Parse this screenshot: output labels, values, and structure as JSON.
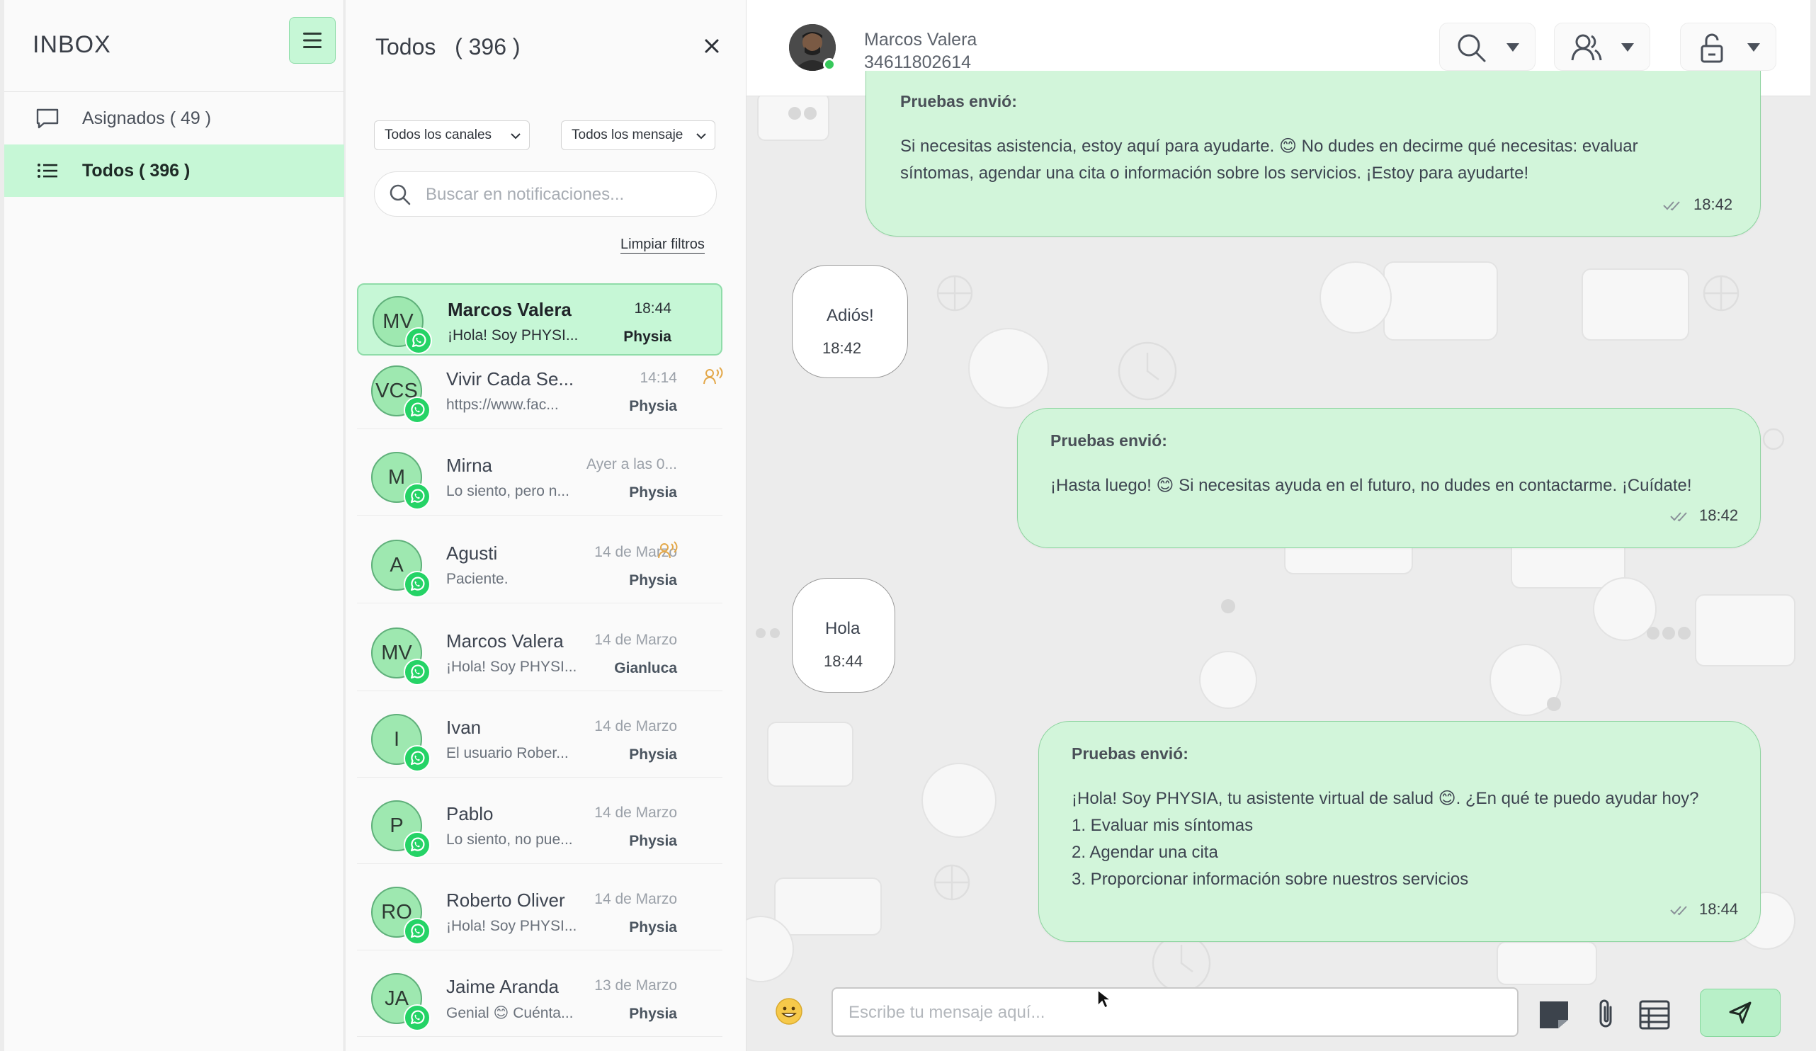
{
  "sidebar": {
    "title": "INBOX",
    "menu_icon": "hamburger-menu-icon",
    "nav": [
      {
        "label": "Asignados ( 49 )",
        "icon": "chat-bubble-icon",
        "active": false
      },
      {
        "label": "Todos ( 396 )",
        "icon": "list-icon",
        "active": true
      }
    ]
  },
  "list": {
    "title": "Todos   ( 396 )",
    "close_icon": "close-icon",
    "filters": {
      "channels": "Todos los canales",
      "messages": "Todos los mensaje"
    },
    "search_placeholder": "Buscar en notificaciones...",
    "clear_filters": "Limpiar filtros",
    "conversations": [
      {
        "initials": "MV",
        "name": "Marcos Valera",
        "preview": "¡Hola! Soy PHYSI...",
        "time": "18:44",
        "owner": "Physia",
        "active": true,
        "agent_icon": false
      },
      {
        "initials": "VCS",
        "name": "Vivir Cada Se...",
        "preview": "https://www.fac...",
        "time": "14:14",
        "owner": "Physia",
        "active": false,
        "agent_icon": true
      },
      {
        "initials": "M",
        "name": "Mirna",
        "preview": "Lo siento, pero n...",
        "time": "Ayer a las 0...",
        "owner": "Physia",
        "active": false,
        "agent_icon": false
      },
      {
        "initials": "A",
        "name": "Agusti",
        "preview": "Paciente.",
        "time": "14 de Marzo",
        "owner": "Physia",
        "active": false,
        "agent_icon": true
      },
      {
        "initials": "MV",
        "name": "Marcos Valera",
        "preview": "¡Hola! Soy PHYSI...",
        "time": "14 de Marzo",
        "owner": "Gianluca",
        "active": false,
        "agent_icon": false
      },
      {
        "initials": "I",
        "name": "Ivan",
        "preview": "El usuario Rober...",
        "time": "14 de Marzo",
        "owner": "Physia",
        "active": false,
        "agent_icon": false
      },
      {
        "initials": "P",
        "name": "Pablo",
        "preview": "Lo siento, no pue...",
        "time": "14 de Marzo",
        "owner": "Physia",
        "active": false,
        "agent_icon": false
      },
      {
        "initials": "RO",
        "name": "Roberto Oliver",
        "preview": "¡Hola! Soy PHYSI...",
        "time": "14 de Marzo",
        "owner": "Physia",
        "active": false,
        "agent_icon": false
      },
      {
        "initials": "JA",
        "name": "Jaime Aranda",
        "preview": "Genial 😊 Cuénta...",
        "time": "13 de Marzo",
        "owner": "Physia",
        "active": false,
        "agent_icon": false
      }
    ]
  },
  "chat": {
    "contact_name": "Marcos Valera",
    "contact_phone": "34611802614",
    "header_buttons": [
      "search-icon",
      "user-icon",
      "lock-icon"
    ],
    "messages": [
      {
        "direction": "out",
        "from": "Pruebas envió:",
        "text": "Si necesitas asistencia, estoy aquí para ayudarte. 😊 No dudes en decirme qué necesitas: evaluar\nsíntomas, agendar una cita o información sobre los servicios. ¡Estoy para ayudarte!",
        "time": "18:42"
      },
      {
        "direction": "in",
        "text": "Adiós!",
        "time": "18:42"
      },
      {
        "direction": "out",
        "from": "Pruebas envió:",
        "text": "¡Hasta luego! 😊 Si necesitas ayuda en el futuro, no dudes en contactarme. ¡Cuídate!",
        "time": "18:42"
      },
      {
        "direction": "in",
        "text": "Hola",
        "time": "18:44"
      },
      {
        "direction": "out",
        "from": "Pruebas envió:",
        "text": "¡Hola! Soy PHYSIA, tu asistente virtual de salud 😊. ¿En qué te puedo ayudar hoy?\n1. Evaluar mis síntomas\n2. Agendar una cita\n3. Proporcionar información sobre nuestros servicios",
        "time": "18:44"
      }
    ],
    "composer": {
      "placeholder": "Escribe tu mensaje aquí...",
      "emoji_icon": "emoji-icon",
      "buttons": [
        "note-icon",
        "paperclip-icon",
        "table-icon",
        "send-icon"
      ]
    }
  },
  "colors": {
    "accent_green": "#c6f7d6",
    "bubble_out": "#d2f5da",
    "border_green": "#8dd49f",
    "whatsapp_green": "#25d366"
  }
}
